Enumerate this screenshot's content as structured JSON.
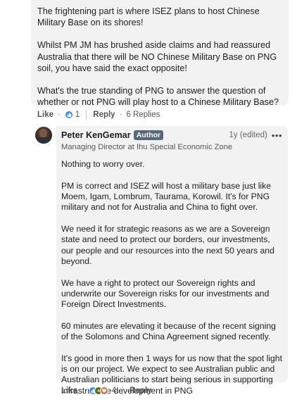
{
  "top_comment": {
    "paragraphs": [
      "The frightening part is where ISEZ plans to host Chinese Military Base on its shores!",
      "Whilst PM JM has brushed aside claims and had reassured Australia that there will be NO Chinese Military Base on PNG soil, you have said the exact opposite!",
      "What's the true standing of PNG to answer the question of whether or not PNG will play host to a Chinese Military Base?"
    ],
    "like_label": "Like",
    "dot": "·",
    "reaction_count": "1",
    "reply_label": "Reply",
    "replies_label": "6 Replies"
  },
  "reply": {
    "author_name": "Peter KenGemar",
    "author_badge": "Author",
    "time": "1y (edited)",
    "more": "•••",
    "headline": "Managing Director at Ihu Special Economic Zone",
    "paragraphs": [
      "Nothing to worry over.",
      "PM is correct and ISEZ will host a military base just like Moem, Igam, Lombrum, Taurama, Korowil. It's for PNG military and not for Australia and China to fight over.",
      "We need it for strategic reasons as we are a Sovereign state and need to protect our borders, our investments, our people and our resources into the next 50 years and beyond.",
      "We have a right to protect our Sovereign rights and underwrite our Sovereign risks for our investments and Foreign Direct Investments.",
      "60 minutes are elevating it because of the recent signing of the Solomons and China Agreement signed recently.",
      "It's good in more then 1 ways for us now that the spot light is on our project. We expect to see Australian public and Australian politicians to start being serious in supporting infrastructure development in PNG"
    ],
    "like_label": "Like",
    "dot": "·",
    "reaction_count": "4",
    "reply_label": "Reply"
  },
  "icons": {
    "like": "like-reaction-icon",
    "celebrate": "celebrate-reaction-icon",
    "love": "love-reaction-icon",
    "more": "more-options-icon"
  },
  "colors": {
    "bubble": "#f2f2f2",
    "like_blue": "#378fe9",
    "badge": "#56687a"
  }
}
